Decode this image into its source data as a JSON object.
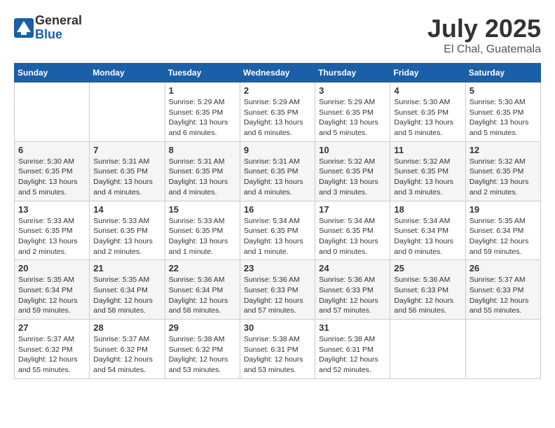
{
  "logo": {
    "general": "General",
    "blue": "Blue"
  },
  "title": {
    "month_year": "July 2025",
    "location": "El Chal, Guatemala"
  },
  "weekdays": [
    "Sunday",
    "Monday",
    "Tuesday",
    "Wednesday",
    "Thursday",
    "Friday",
    "Saturday"
  ],
  "weeks": [
    [
      {
        "day": "",
        "info": ""
      },
      {
        "day": "",
        "info": ""
      },
      {
        "day": "1",
        "info": "Sunrise: 5:29 AM\nSunset: 6:35 PM\nDaylight: 13 hours and 6 minutes."
      },
      {
        "day": "2",
        "info": "Sunrise: 5:29 AM\nSunset: 6:35 PM\nDaylight: 13 hours and 6 minutes."
      },
      {
        "day": "3",
        "info": "Sunrise: 5:29 AM\nSunset: 6:35 PM\nDaylight: 13 hours and 5 minutes."
      },
      {
        "day": "4",
        "info": "Sunrise: 5:30 AM\nSunset: 6:35 PM\nDaylight: 13 hours and 5 minutes."
      },
      {
        "day": "5",
        "info": "Sunrise: 5:30 AM\nSunset: 6:35 PM\nDaylight: 13 hours and 5 minutes."
      }
    ],
    [
      {
        "day": "6",
        "info": "Sunrise: 5:30 AM\nSunset: 6:35 PM\nDaylight: 13 hours and 5 minutes."
      },
      {
        "day": "7",
        "info": "Sunrise: 5:31 AM\nSunset: 6:35 PM\nDaylight: 13 hours and 4 minutes."
      },
      {
        "day": "8",
        "info": "Sunrise: 5:31 AM\nSunset: 6:35 PM\nDaylight: 13 hours and 4 minutes."
      },
      {
        "day": "9",
        "info": "Sunrise: 5:31 AM\nSunset: 6:35 PM\nDaylight: 13 hours and 4 minutes."
      },
      {
        "day": "10",
        "info": "Sunrise: 5:32 AM\nSunset: 6:35 PM\nDaylight: 13 hours and 3 minutes."
      },
      {
        "day": "11",
        "info": "Sunrise: 5:32 AM\nSunset: 6:35 PM\nDaylight: 13 hours and 3 minutes."
      },
      {
        "day": "12",
        "info": "Sunrise: 5:32 AM\nSunset: 6:35 PM\nDaylight: 13 hours and 2 minutes."
      }
    ],
    [
      {
        "day": "13",
        "info": "Sunrise: 5:33 AM\nSunset: 6:35 PM\nDaylight: 13 hours and 2 minutes."
      },
      {
        "day": "14",
        "info": "Sunrise: 5:33 AM\nSunset: 6:35 PM\nDaylight: 13 hours and 2 minutes."
      },
      {
        "day": "15",
        "info": "Sunrise: 5:33 AM\nSunset: 6:35 PM\nDaylight: 13 hours and 1 minute."
      },
      {
        "day": "16",
        "info": "Sunrise: 5:34 AM\nSunset: 6:35 PM\nDaylight: 13 hours and 1 minute."
      },
      {
        "day": "17",
        "info": "Sunrise: 5:34 AM\nSunset: 6:35 PM\nDaylight: 13 hours and 0 minutes."
      },
      {
        "day": "18",
        "info": "Sunrise: 5:34 AM\nSunset: 6:34 PM\nDaylight: 13 hours and 0 minutes."
      },
      {
        "day": "19",
        "info": "Sunrise: 5:35 AM\nSunset: 6:34 PM\nDaylight: 12 hours and 59 minutes."
      }
    ],
    [
      {
        "day": "20",
        "info": "Sunrise: 5:35 AM\nSunset: 6:34 PM\nDaylight: 12 hours and 59 minutes."
      },
      {
        "day": "21",
        "info": "Sunrise: 5:35 AM\nSunset: 6:34 PM\nDaylight: 12 hours and 58 minutes."
      },
      {
        "day": "22",
        "info": "Sunrise: 5:36 AM\nSunset: 6:34 PM\nDaylight: 12 hours and 58 minutes."
      },
      {
        "day": "23",
        "info": "Sunrise: 5:36 AM\nSunset: 6:33 PM\nDaylight: 12 hours and 57 minutes."
      },
      {
        "day": "24",
        "info": "Sunrise: 5:36 AM\nSunset: 6:33 PM\nDaylight: 12 hours and 57 minutes."
      },
      {
        "day": "25",
        "info": "Sunrise: 5:36 AM\nSunset: 6:33 PM\nDaylight: 12 hours and 56 minutes."
      },
      {
        "day": "26",
        "info": "Sunrise: 5:37 AM\nSunset: 6:33 PM\nDaylight: 12 hours and 55 minutes."
      }
    ],
    [
      {
        "day": "27",
        "info": "Sunrise: 5:37 AM\nSunset: 6:32 PM\nDaylight: 12 hours and 55 minutes."
      },
      {
        "day": "28",
        "info": "Sunrise: 5:37 AM\nSunset: 6:32 PM\nDaylight: 12 hours and 54 minutes."
      },
      {
        "day": "29",
        "info": "Sunrise: 5:38 AM\nSunset: 6:32 PM\nDaylight: 12 hours and 53 minutes."
      },
      {
        "day": "30",
        "info": "Sunrise: 5:38 AM\nSunset: 6:31 PM\nDaylight: 12 hours and 53 minutes."
      },
      {
        "day": "31",
        "info": "Sunrise: 5:38 AM\nSunset: 6:31 PM\nDaylight: 12 hours and 52 minutes."
      },
      {
        "day": "",
        "info": ""
      },
      {
        "day": "",
        "info": ""
      }
    ]
  ]
}
